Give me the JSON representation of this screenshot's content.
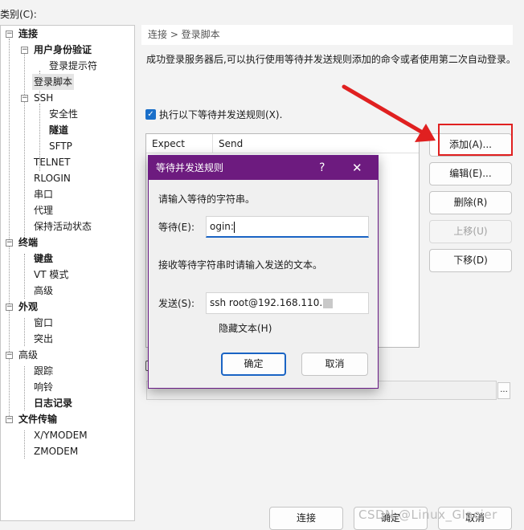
{
  "category_label": "类别(C):",
  "tree": [
    {
      "label": "连接",
      "bold": true
    },
    {
      "label": "用户身份验证",
      "bold": true
    },
    {
      "label": "登录提示符",
      "bold": false
    },
    {
      "label": "登录脚本",
      "bold": false,
      "selected": true
    },
    {
      "label": "SSH",
      "bold": false
    },
    {
      "label": "安全性",
      "bold": false
    },
    {
      "label": "隧道",
      "bold": true
    },
    {
      "label": "SFTP",
      "bold": false
    },
    {
      "label": "TELNET",
      "bold": false
    },
    {
      "label": "RLOGIN",
      "bold": false
    },
    {
      "label": "串口",
      "bold": false
    },
    {
      "label": "代理",
      "bold": false
    },
    {
      "label": "保持活动状态",
      "bold": false
    },
    {
      "label": "终端",
      "bold": true
    },
    {
      "label": "键盘",
      "bold": true
    },
    {
      "label": "VT 模式",
      "bold": false
    },
    {
      "label": "高级",
      "bold": false
    },
    {
      "label": "外观",
      "bold": true
    },
    {
      "label": "窗口",
      "bold": false
    },
    {
      "label": "突出",
      "bold": false
    },
    {
      "label": "高级",
      "bold": false
    },
    {
      "label": "跟踪",
      "bold": false
    },
    {
      "label": "响铃",
      "bold": false
    },
    {
      "label": "日志记录",
      "bold": true
    },
    {
      "label": "文件传输",
      "bold": true
    },
    {
      "label": "X/YMODEM",
      "bold": false
    },
    {
      "label": "ZMODEM",
      "bold": false
    }
  ],
  "breadcrumb": "连接 > 登录脚本",
  "description": "成功登录服务器后,可以执行使用等待并发送规则添加的命令或者使用第二次自动登录。",
  "rule_checkbox": {
    "label": "执行以下等待并发送规则(X).",
    "checked": true
  },
  "list": {
    "col_expect": "Expect",
    "col_send": "Send"
  },
  "buttons": {
    "add": "添加(A)...",
    "edit": "编辑(E)...",
    "delete": "删除(R)",
    "move_up": "上移(U)",
    "move_down": "下移(D)",
    "ellipsis": "...",
    "connect": "连接",
    "ok": "确定",
    "cancel": "取消"
  },
  "dialog": {
    "title": "等待并发送规则",
    "help": "?",
    "close": "✕",
    "wait_prompt": "请输入等待的字符串。",
    "wait_label": "等待(E):",
    "wait_value": "ogin:",
    "send_prompt": "接收等待字符串时请输入发送的文本。",
    "send_label": "发送(S):",
    "send_value": "ssh root@192.168.110.",
    "hide_label": "隐藏文本(H)",
    "hide_checked": false,
    "ok": "确定",
    "cancel": "取消"
  },
  "watermark": "CSDN @Linux_Glacier",
  "colors": {
    "dialog_title": "#6d1b7f",
    "highlight": "#e02020",
    "accent": "#1a64c4"
  }
}
